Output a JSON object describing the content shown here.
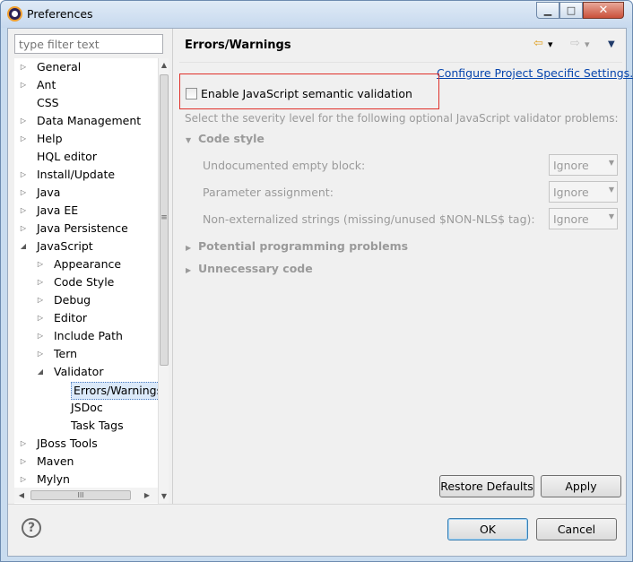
{
  "window": {
    "title": "Preferences",
    "minimize_glyph": "▁",
    "maximize_glyph": "□",
    "close_glyph": "✕"
  },
  "filter": {
    "placeholder": "type filter text"
  },
  "tree": {
    "items": [
      {
        "label": "General",
        "expander": "▷",
        "level": 0
      },
      {
        "label": "Ant",
        "expander": "▷",
        "level": 0
      },
      {
        "label": "CSS",
        "expander": "",
        "level": 0
      },
      {
        "label": "Data Management",
        "expander": "▷",
        "level": 0
      },
      {
        "label": "Help",
        "expander": "▷",
        "level": 0
      },
      {
        "label": "HQL editor",
        "expander": "",
        "level": 0
      },
      {
        "label": "Install/Update",
        "expander": "▷",
        "level": 0
      },
      {
        "label": "Java",
        "expander": "▷",
        "level": 0
      },
      {
        "label": "Java EE",
        "expander": "▷",
        "level": 0
      },
      {
        "label": "Java Persistence",
        "expander": "▷",
        "level": 0
      },
      {
        "label": "JavaScript",
        "expander": "◢",
        "level": 0
      },
      {
        "label": "Appearance",
        "expander": "▷",
        "level": 1
      },
      {
        "label": "Code Style",
        "expander": "▷",
        "level": 1
      },
      {
        "label": "Debug",
        "expander": "▷",
        "level": 1
      },
      {
        "label": "Editor",
        "expander": "▷",
        "level": 1
      },
      {
        "label": "Include Path",
        "expander": "▷",
        "level": 1
      },
      {
        "label": "Tern",
        "expander": "▷",
        "level": 1
      },
      {
        "label": "Validator",
        "expander": "◢",
        "level": 1
      },
      {
        "label": "Errors/Warnings",
        "expander": "",
        "level": 2,
        "selected": true
      },
      {
        "label": "JSDoc",
        "expander": "",
        "level": 2
      },
      {
        "label": "Task Tags",
        "expander": "",
        "level": 2
      },
      {
        "label": "JBoss Tools",
        "expander": "▷",
        "level": 0
      },
      {
        "label": "Maven",
        "expander": "▷",
        "level": 0
      },
      {
        "label": "Mylyn",
        "expander": "▷",
        "level": 0
      }
    ],
    "scroll": {
      "up": "▲",
      "down": "▼",
      "left": "◀",
      "right": "▶",
      "grip_v": "≡",
      "grip_h": "III"
    }
  },
  "page": {
    "title": "Errors/Warnings",
    "nav": {
      "back_icon": "⇦",
      "back_menu": "▾",
      "forward_icon": "⇨",
      "forward_menu": "▾",
      "view_menu": "▼"
    },
    "config_link": "Configure Project Specific Settings...",
    "enable_label": "Enable JavaScript semantic validation",
    "enable_checked": false,
    "instructions": "Select the severity level for the following optional JavaScript validator problems:",
    "sections": [
      {
        "label": "Code style",
        "arrow": "▼",
        "expanded": true,
        "options": [
          {
            "label": "Undocumented empty block:",
            "value": "Ignore"
          },
          {
            "label": "Parameter assignment:",
            "value": "Ignore"
          },
          {
            "label": "Non-externalized strings (missing/unused $NON-NLS$ tag):",
            "value": "Ignore"
          }
        ]
      },
      {
        "label": "Potential programming problems",
        "arrow": "▶",
        "expanded": false
      },
      {
        "label": "Unnecessary code",
        "arrow": "▶",
        "expanded": false
      }
    ],
    "combo_arrow": "▼",
    "restore_label": "Restore Defaults",
    "apply_label": "Apply"
  },
  "footer": {
    "help_glyph": "?",
    "ok_label": "OK",
    "cancel_label": "Cancel"
  },
  "colors": {
    "accent_border": "#e0302a",
    "link": "#0645ad",
    "disabled_text": "#9a9a9a",
    "title_bar": "#c7d9ee"
  }
}
